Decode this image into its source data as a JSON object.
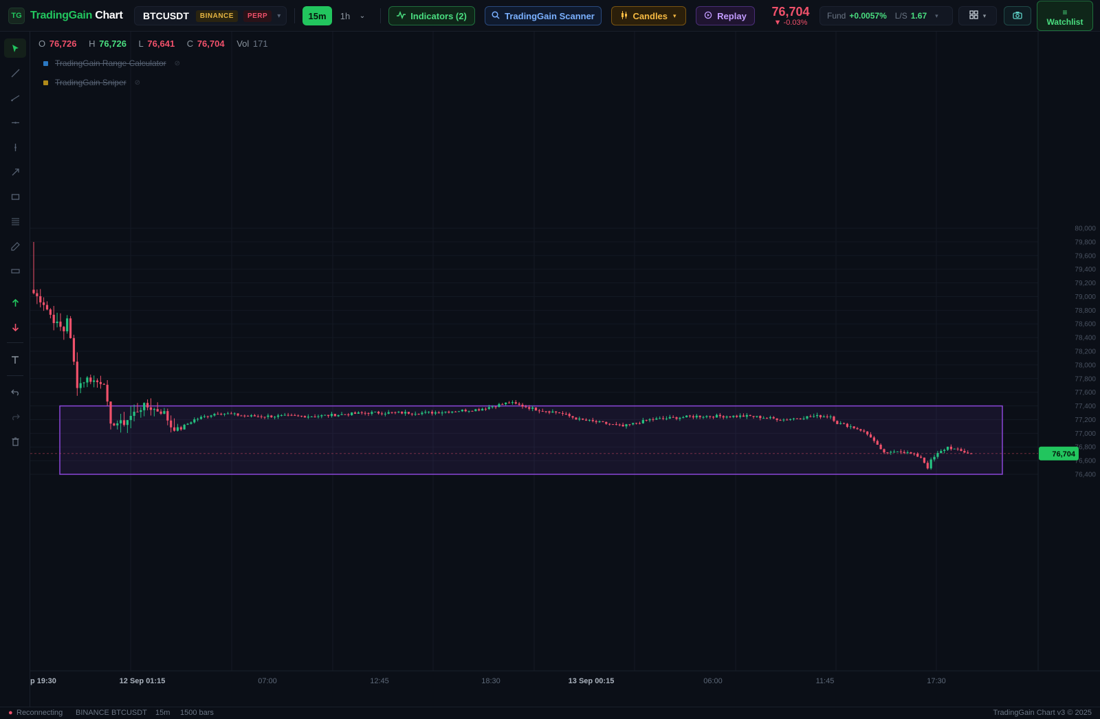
{
  "app": {
    "logo_mark": "TG",
    "name_brand": "TradingGain",
    "name_suffix": "Chart"
  },
  "symbol": {
    "name": "BTCUSDT",
    "exchange": "BINANCE",
    "type": "PERP"
  },
  "timeframes": {
    "active": "15m",
    "other": "1h"
  },
  "toolbar": {
    "indicators_label": "Indicators (2)",
    "scanner_label": "TradingGain Scanner",
    "candles_label": "Candles",
    "replay_label": "Replay",
    "watchlist_label": "Watchlist"
  },
  "ticker": {
    "price": "76,704",
    "change": "▼ -0.03%"
  },
  "funding": {
    "fund_label": "Fund",
    "fund_value": "+0.0057%",
    "ls_label": "L/S",
    "ls_value": "1.67"
  },
  "legend": {
    "o_label": "O",
    "o": "76,726",
    "h_label": "H",
    "h": "76,726",
    "l_label": "L",
    "l": "76,641",
    "c_label": "C",
    "c": "76,704",
    "vol_label": "Vol",
    "vol": "171",
    "indicators": [
      {
        "name": "TradingGain Range Calculator",
        "color": "#2b78c2"
      },
      {
        "name": "TradingGain Sniper",
        "color": "#b08a1a"
      }
    ]
  },
  "colors": {
    "up": "#26c281",
    "down": "#f0516b",
    "range_box": "#8b47d9",
    "accent": "#22c55e"
  },
  "status": {
    "connection": "Reconnecting",
    "feed": "BINANCE BTCUSDT",
    "timeframe": "15m",
    "bars": "1500 bars",
    "version": "TradingGain Chart v3 © 2025"
  },
  "left_tools": [
    "cursor-icon",
    "trendline-icon",
    "ray-icon",
    "horizontal-line-icon",
    "vertical-line-icon",
    "arrow-icon",
    "rectangle-icon",
    "fib-icon",
    "brush-icon",
    "ruler-icon",
    "long-position-icon",
    "short-position-icon",
    "text-icon",
    "undo-icon",
    "redo-icon",
    "trash-icon"
  ],
  "chart_data": {
    "type": "candlestick",
    "symbol": "BTCUSDT",
    "timeframe": "15m",
    "last_price_label": "76,704",
    "y_ticks": [
      "80,000",
      "79,800",
      "79,600",
      "79,400",
      "79,200",
      "79,000",
      "78,800",
      "78,600",
      "78,400",
      "78,200",
      "78,000",
      "77,800",
      "77,600",
      "77,400",
      "77,200",
      "77,000",
      "76,800",
      "76,600",
      "76,400"
    ],
    "x_ticks": [
      "p 19:30",
      "12 Sep 01:15",
      "07:00",
      "12:45",
      "18:30",
      "13 Sep 00:15",
      "06:00",
      "11:45",
      "17:30"
    ],
    "x_ticks_bold": [
      true,
      true,
      false,
      false,
      false,
      true,
      false,
      false,
      false
    ],
    "ylim": [
      76400,
      80000
    ],
    "range_box": {
      "top": 77400,
      "bottom": 76400
    },
    "last_price": 76704,
    "close_path": [
      [
        0,
        79050
      ],
      [
        3,
        78900
      ],
      [
        6,
        78650
      ],
      [
        9,
        78500
      ],
      [
        10,
        78700
      ],
      [
        13,
        77700
      ],
      [
        16,
        77800
      ],
      [
        19,
        77750
      ],
      [
        21,
        77750
      ],
      [
        23,
        77100
      ],
      [
        24,
        77150
      ],
      [
        27,
        77150
      ],
      [
        30,
        77300
      ],
      [
        33,
        77400
      ],
      [
        36,
        77350
      ],
      [
        39,
        77300
      ],
      [
        41,
        77100
      ],
      [
        43,
        77050
      ],
      [
        48,
        77200
      ],
      [
        55,
        77300
      ],
      [
        64,
        77250
      ],
      [
        74,
        77250
      ],
      [
        84,
        77250
      ],
      [
        100,
        77300
      ],
      [
        118,
        77300
      ],
      [
        133,
        77350
      ],
      [
        142,
        77450
      ],
      [
        150,
        77350
      ],
      [
        157,
        77300
      ],
      [
        163,
        77200
      ],
      [
        170,
        77150
      ],
      [
        176,
        77100
      ],
      [
        184,
        77200
      ],
      [
        198,
        77250
      ],
      [
        214,
        77250
      ],
      [
        224,
        77200
      ],
      [
        233,
        77250
      ],
      [
        238,
        77250
      ],
      [
        240,
        77150
      ],
      [
        244,
        77100
      ],
      [
        247,
        77050
      ],
      [
        250,
        76950
      ],
      [
        253,
        76750
      ],
      [
        255,
        76700
      ],
      [
        258,
        76750
      ],
      [
        262,
        76700
      ],
      [
        265,
        76650
      ],
      [
        267,
        76500
      ],
      [
        268,
        76600
      ],
      [
        270,
        76700
      ],
      [
        273,
        76800
      ],
      [
        276,
        76750
      ],
      [
        280,
        76700
      ]
    ]
  }
}
